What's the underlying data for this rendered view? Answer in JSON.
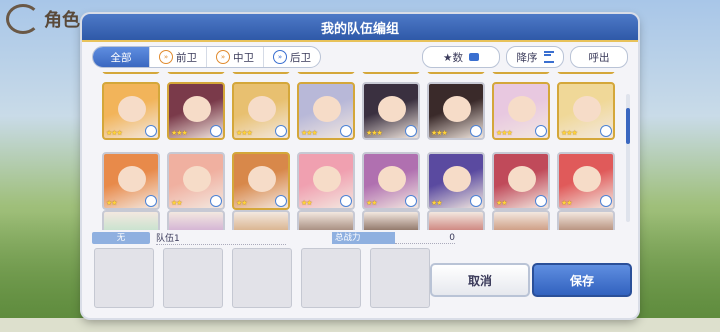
{
  "background": {
    "title": "角色"
  },
  "header": {
    "title": "我的队伍编组"
  },
  "filters": {
    "tabs": [
      {
        "label": "全部",
        "active": true
      },
      {
        "label": "前卫",
        "active": false
      },
      {
        "label": "中卫",
        "active": false
      },
      {
        "label": "后卫",
        "active": false
      }
    ],
    "sort_stars_label": "★数",
    "sort_order_label": "降序",
    "call_label": "呼出"
  },
  "roster": {
    "row1": [
      {
        "stars": "★★★",
        "frame": "gold",
        "color": "#f2b45a"
      },
      {
        "stars": "★★★",
        "frame": "gold",
        "color": "#7a3a4a"
      },
      {
        "stars": "★★★",
        "frame": "gold",
        "color": "#e8c070"
      },
      {
        "stars": "★★★",
        "frame": "gold",
        "color": "#b8b8d8"
      },
      {
        "stars": "★★★",
        "frame": "silver",
        "color": "#3a3040"
      },
      {
        "stars": "★★★",
        "frame": "silver",
        "color": "#3a2a2a"
      },
      {
        "stars": "★★★",
        "frame": "gold",
        "color": "#e8c8e0"
      },
      {
        "stars": "★★★",
        "frame": "gold",
        "color": "#f0d898"
      }
    ],
    "row2": [
      {
        "stars": "★★",
        "frame": "silver",
        "color": "#e88a4a"
      },
      {
        "stars": "★★",
        "frame": "silver",
        "color": "#f0b0a0"
      },
      {
        "stars": "★★",
        "frame": "gold",
        "color": "#d8884a"
      },
      {
        "stars": "★★",
        "frame": "silver",
        "color": "#f0a0b0"
      },
      {
        "stars": "★★",
        "frame": "silver",
        "color": "#b070b0"
      },
      {
        "stars": "★★",
        "frame": "silver",
        "color": "#5a4aa0"
      },
      {
        "stars": "★★",
        "frame": "silver",
        "color": "#c04a5a"
      },
      {
        "stars": "★★",
        "frame": "silver",
        "color": "#e05a5a"
      }
    ],
    "row3_colors": [
      "#b8e0c8",
      "#c8a0d0",
      "#d0a070",
      "#8a6a5a",
      "#6a4a3a",
      "#c0605a",
      "#c08060",
      "#a07058"
    ]
  },
  "team": {
    "none_label": "无",
    "name": "队伍1",
    "power_label": "总战力",
    "power_value": "0"
  },
  "actions": {
    "cancel_label": "取消",
    "save_label": "保存"
  }
}
